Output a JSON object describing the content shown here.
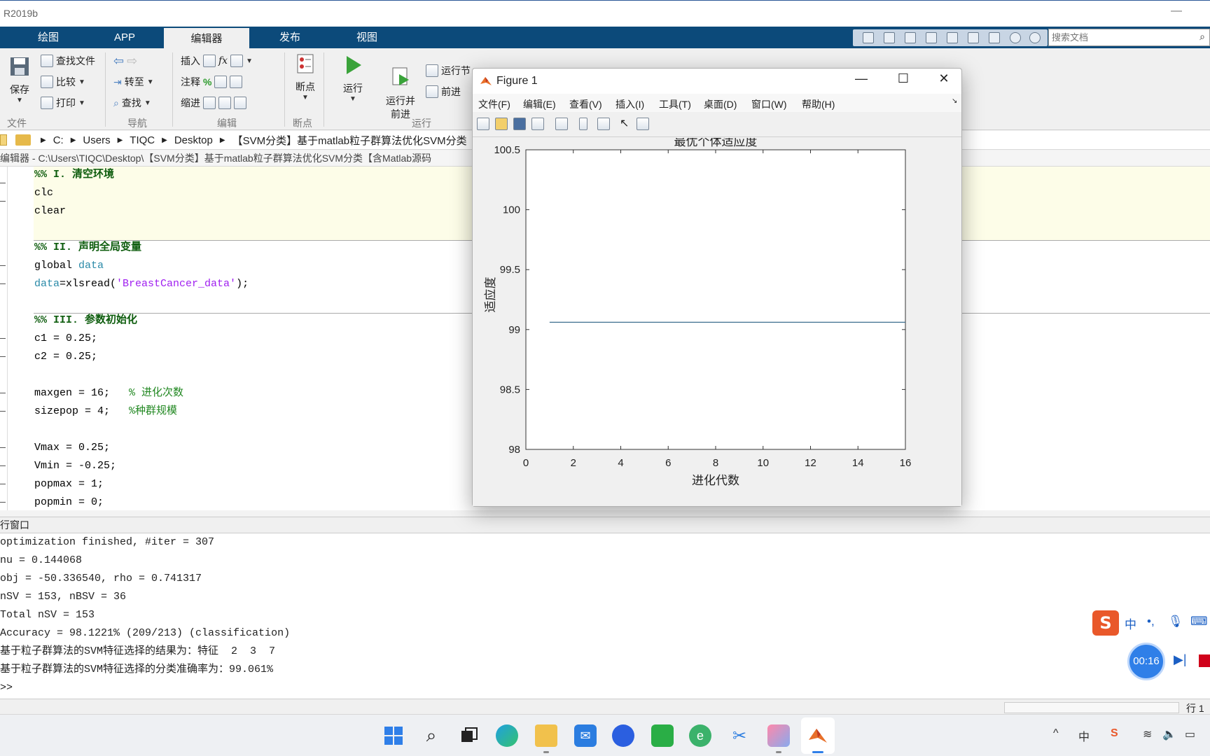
{
  "app": {
    "title": "R2019b",
    "minimize_glyph": "—"
  },
  "tabs": [
    "绘图",
    "APP",
    "编辑器",
    "发布",
    "视图"
  ],
  "search": {
    "placeholder": "搜索文档"
  },
  "ribbon": {
    "file": {
      "save": "保存",
      "find_files": "查找文件",
      "compare": "比较",
      "print": "打印",
      "group": "文件"
    },
    "navigate": {
      "goto": "转至",
      "find": "查找",
      "group": "导航"
    },
    "edit": {
      "insert": "插入",
      "comment": "注释",
      "indent": "缩进",
      "fx": "fx",
      "group": "编辑"
    },
    "breakpoints": {
      "label": "断点",
      "group": "断点"
    },
    "run": {
      "run": "运行",
      "run_advance": "运行并\n前进",
      "run_section": "运行节",
      "advance": "前进",
      "group": "运行"
    }
  },
  "address": {
    "crumbs": [
      "C:",
      "Users",
      "TIQC",
      "Desktop",
      "【SVM分类】基于matlab粒子群算法优化SVM分类【"
    ]
  },
  "editor_path": "编辑器 - C:\\Users\\TIQC\\Desktop\\【SVM分类】基于matlab粒子群算法优化SVM分类【含Matlab源码",
  "code": {
    "l1": "%% I. 清空环境",
    "l2": "clc",
    "l3": "clear",
    "l4": "%% II. 声明全局变量",
    "l5a": "global ",
    "l5b": "data",
    "l6a": "data",
    "l6b": "=xlsread(",
    "l6c": "'BreastCancer_data'",
    "l6d": ");",
    "l7": "%% III. 参数初始化",
    "l8": "c1 = 0.25;",
    "l9": "c2 = 0.25;",
    "l10a": "maxgen = 16;   ",
    "l10b": "% 进化次数",
    "l11a": "sizepop = 4;   ",
    "l11b": "%种群规模",
    "l12": "Vmax = 0.25;",
    "l13": "Vmin = -0.25;",
    "l14": "popmax = 1;",
    "l15": "popmin = 0;"
  },
  "command_window": {
    "header": "行窗口",
    "lines": [
      "optimization finished, #iter = 307",
      "nu = 0.144068",
      "obj = -50.336540, rho = 0.741317",
      "nSV = 153, nBSV = 36",
      "Total nSV = 153",
      "Accuracy = 98.1221% (209/213) (classification)",
      "基于粒子群算法的SVM特征选择的结果为：特征  2  3  7",
      "基于粒子群算法的SVM特征选择的分类准确率为：99.061%",
      ">>"
    ]
  },
  "status": {
    "row": "行 1"
  },
  "figure": {
    "title": "Figure 1",
    "menu": [
      "文件(F)",
      "编辑(E)",
      "查看(V)",
      "插入(I)",
      "工具(T)",
      "桌面(D)",
      "窗口(W)",
      "帮助(H)"
    ]
  },
  "ime": {
    "zh": "中",
    "punct": "•,",
    "timer": "00:16"
  },
  "tray": {
    "input": "中"
  },
  "colors": {
    "tab_bg": "#0c4a7a",
    "plot_line": "#3d6f8f",
    "comment": "#228822",
    "string": "#a020f0",
    "taskbar_accent": "#2f7fe8"
  },
  "chart_data": {
    "type": "line",
    "title": "最优个体适应度",
    "xlabel": "进化代数",
    "ylabel": "适应度",
    "xlim": [
      0,
      16
    ],
    "ylim": [
      98,
      100.5
    ],
    "xticks": [
      "0",
      "2",
      "4",
      "6",
      "8",
      "10",
      "12",
      "14",
      "16"
    ],
    "yticks": [
      "98",
      "98.5",
      "99",
      "99.5",
      "100",
      "100.5"
    ],
    "series": [
      {
        "x": [
          1,
          2,
          3,
          4,
          5,
          6,
          7,
          8,
          9,
          10,
          11,
          12,
          13,
          14,
          15,
          16
        ],
        "y": [
          99.061,
          99.061,
          99.061,
          99.061,
          99.061,
          99.061,
          99.061,
          99.061,
          99.061,
          99.061,
          99.061,
          99.061,
          99.061,
          99.061,
          99.061,
          99.061
        ]
      }
    ]
  }
}
